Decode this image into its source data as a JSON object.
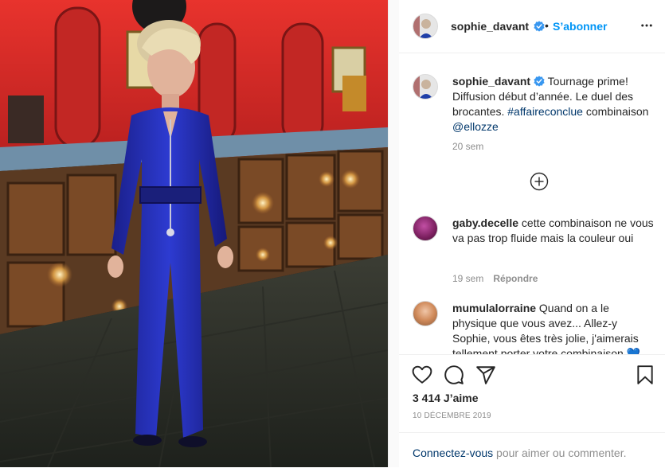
{
  "post": {
    "author": "sophie_davant",
    "follow_label": "S’abonner",
    "separator": "•"
  },
  "caption": {
    "username": "sophie_davant",
    "text_1": "Tournage prime! Diffusion début d’année. Le duel des brocantes. ",
    "hashtag": "#affaireconclue",
    "text_2": " combinaison ",
    "mention": "@ellozze",
    "time": "20 sem"
  },
  "comments": [
    {
      "username": "gaby.decelle",
      "text": "cette combinaison ne vous va pas trop fluide mais la couleur oui",
      "time": "19 sem",
      "reply_label": "Répondre",
      "avatar_color": "#8a2a6e"
    },
    {
      "username": "mumulalorraine",
      "text": "Quand on a le physique que vous avez... Allez-y Sophie, vous êtes très jolie, j'aimerais tellement porter votre combinaison 💙",
      "avatar_color": "#d9a27a"
    }
  ],
  "stats": {
    "likes": "3 414 J’aime",
    "date": "10 décembre 2019"
  },
  "footer": {
    "login_link": "Connectez-vous",
    "login_rest": " pour aimer ou commenter."
  },
  "icons": {
    "verified": "verified-badge-icon",
    "more": "more-options-icon",
    "load_more": "plus-circle-icon",
    "like": "heart-icon",
    "comment": "comment-icon",
    "share": "paper-plane-icon",
    "save": "bookmark-icon"
  },
  "colors": {
    "accent_blue": "#0095f6",
    "link_blue": "#00376b",
    "muted": "#8e8e8e",
    "text": "#262626"
  }
}
